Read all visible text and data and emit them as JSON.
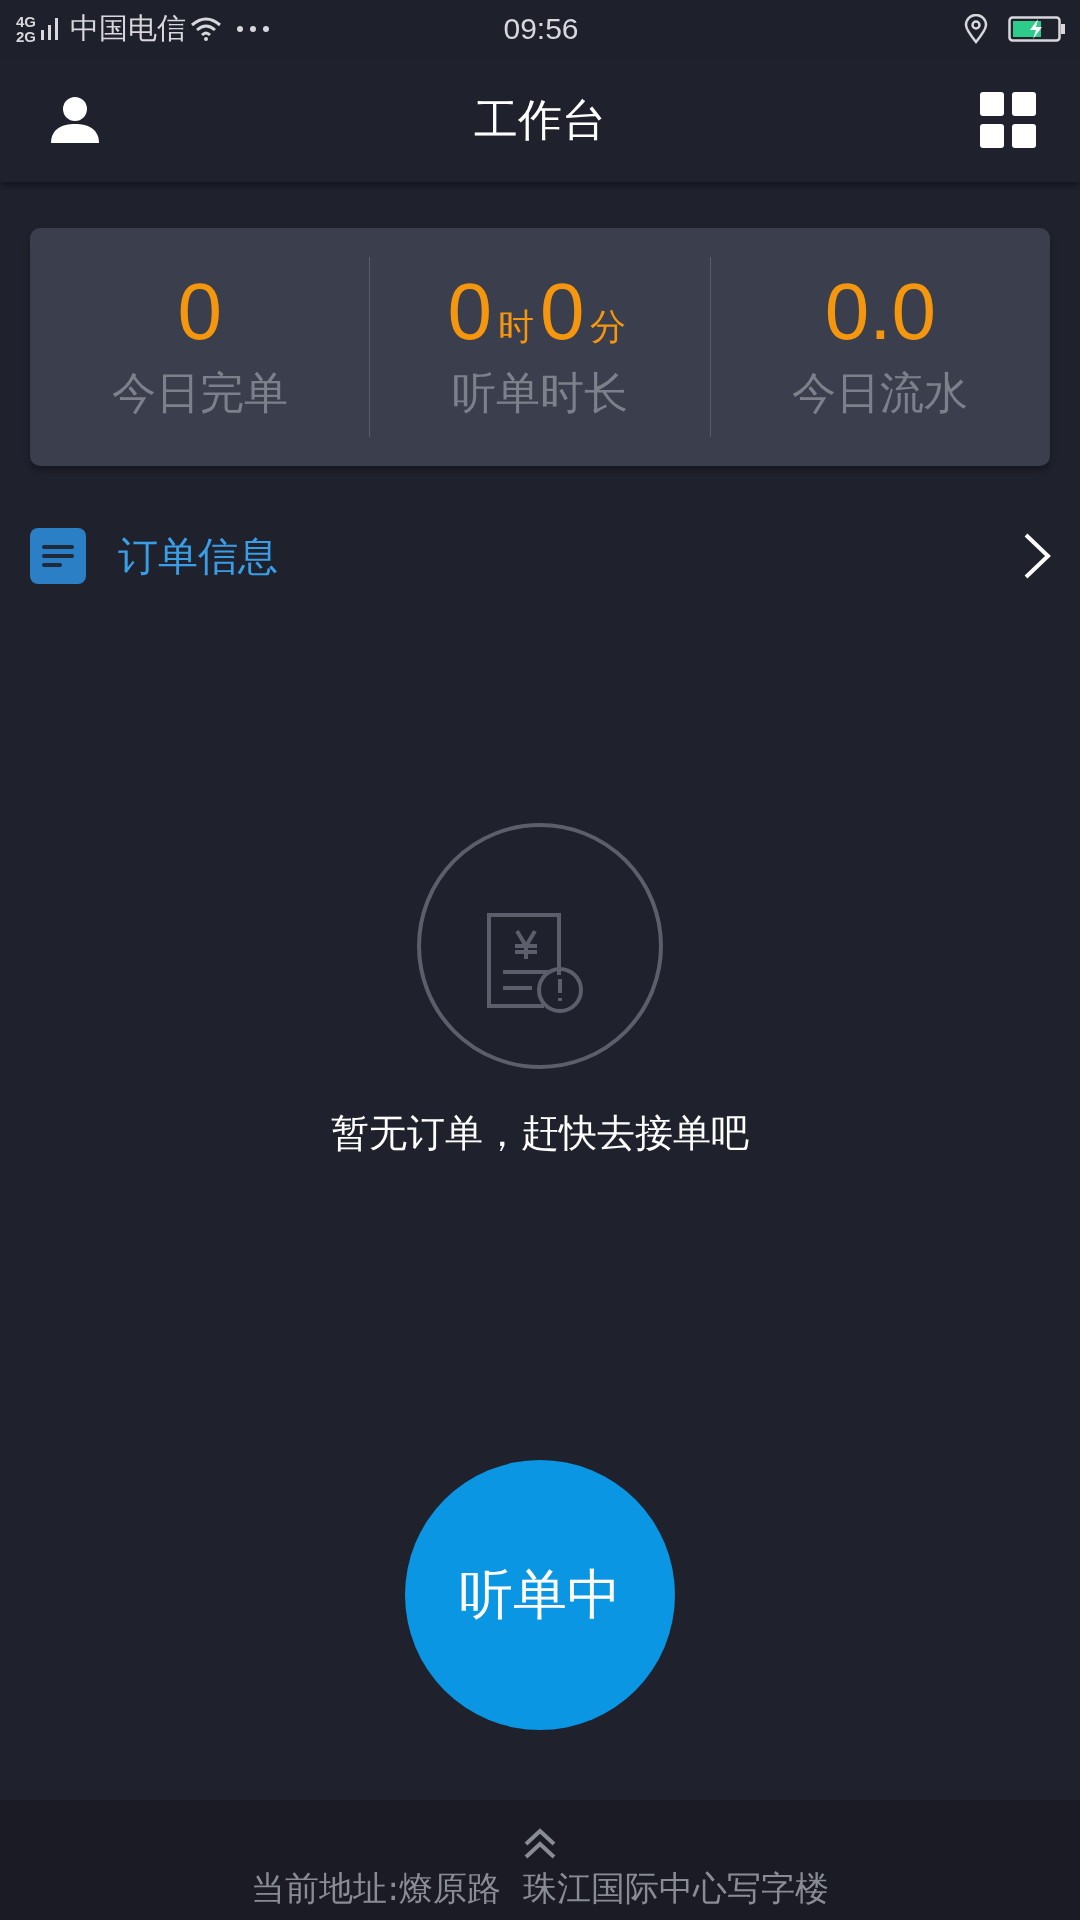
{
  "status_bar": {
    "network": [
      "4G",
      "2G"
    ],
    "carrier": "中国电信",
    "time": "09:56"
  },
  "header": {
    "title": "工作台"
  },
  "stats": [
    {
      "parts": [
        {
          "text": "0",
          "kind": "number"
        }
      ],
      "label": "今日完单"
    },
    {
      "parts": [
        {
          "text": "0",
          "kind": "number"
        },
        {
          "text": "时",
          "kind": "unit"
        },
        {
          "text": "0",
          "kind": "number"
        },
        {
          "text": "分",
          "kind": "unit"
        }
      ],
      "label": "听单时长"
    },
    {
      "parts": [
        {
          "text": "0.0",
          "kind": "number"
        }
      ],
      "label": "今日流水"
    }
  ],
  "order_info": {
    "label": "订单信息"
  },
  "empty_state": {
    "message": "暂无订单，赶快去接单吧"
  },
  "listen_button": {
    "label": "听单中"
  },
  "bottom_bar": {
    "address": "当前地址:燎原路  珠江国际中心写字楼"
  }
}
